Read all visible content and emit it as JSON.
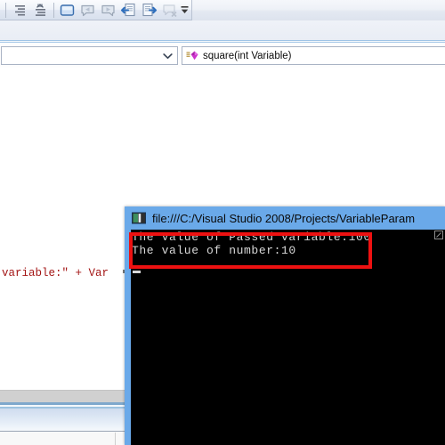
{
  "toolbar": {
    "buttons": [
      {
        "name": "indent-decrease-icon",
        "label": "Decrease Indent"
      },
      {
        "name": "indent-comment-icon",
        "label": "Comment Selection"
      },
      {
        "name": "window-icon",
        "label": "Toggle Window"
      },
      {
        "name": "navigate-backward-icon",
        "label": "Navigate Backward"
      },
      {
        "name": "navigate-forward-icon",
        "label": "Navigate Forward"
      },
      {
        "name": "find-in-files-icon",
        "label": "Find in Files"
      },
      {
        "name": "replace-in-files-icon",
        "label": "Replace in Files"
      },
      {
        "name": "clear-bookmarks-icon",
        "label": "Clear Bookmarks"
      }
    ],
    "overflow_label": "Toolbar Options"
  },
  "combo_bar": {
    "class_combo": {
      "value": "",
      "placeholder": "",
      "chevron": "chevron-down-icon"
    },
    "member_combo": {
      "value": "square(int Variable)",
      "icon": "method-purple-icon"
    }
  },
  "editor": {
    "visible_code": "variable:\" + Var",
    "code_color": "#a31515"
  },
  "console": {
    "title": "file:///C:/Visual Studio 2008/Projects/VariableParam",
    "title_icon": "console-window-icon",
    "lines": [
      "The Value of Passed variable:100",
      "The value of number:10"
    ],
    "caret": "_",
    "background": "#000000",
    "border_color": "#6aa9e9",
    "text_color": "#d8d8d8"
  },
  "annotation": {
    "shape": "rectangle",
    "color": "#ee1111",
    "target": "console-output-lines"
  }
}
